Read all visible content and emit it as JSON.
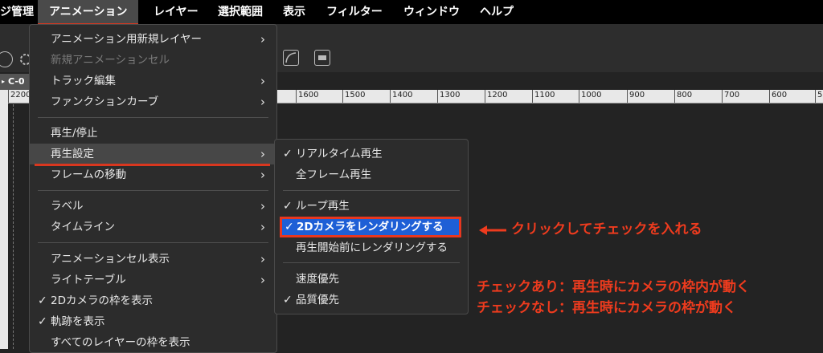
{
  "menubar": {
    "items": [
      "ジ管理",
      "アニメーション",
      "レイヤー",
      "選択範囲",
      "表示",
      "フィルター",
      "ウィンドウ",
      "ヘルプ"
    ]
  },
  "tab": {
    "label": "C-0"
  },
  "ruler": {
    "ticks": [
      "2200",
      "1600",
      "1500",
      "1400",
      "1300",
      "1200",
      "1100",
      "1000",
      "900",
      "800",
      "700",
      "600",
      "5"
    ]
  },
  "menu": {
    "items": [
      {
        "label": "アニメーション用新規レイヤー",
        "submenu": true
      },
      {
        "label": "新規アニメーションセル",
        "disabled": true
      },
      {
        "label": "トラック編集",
        "submenu": true
      },
      {
        "label": "ファンクションカーブ",
        "submenu": true
      },
      {
        "label": "再生/停止"
      },
      {
        "label": "再生設定",
        "submenu": true,
        "highlighted": true
      },
      {
        "label": "フレームの移動",
        "submenu": true
      },
      {
        "label": "ラベル",
        "submenu": true
      },
      {
        "label": "タイムライン",
        "submenu": true
      },
      {
        "label": "アニメーションセル表示",
        "submenu": true
      },
      {
        "label": "ライトテーブル",
        "submenu": true
      },
      {
        "label": "2Dカメラの枠を表示",
        "checked": true
      },
      {
        "label": "軌跡を表示",
        "checked": true
      },
      {
        "label": "すべてのレイヤーの枠を表示"
      }
    ]
  },
  "submenu": {
    "items": [
      {
        "label": "リアルタイム再生",
        "checked": true
      },
      {
        "label": "全フレーム再生"
      },
      {
        "label": "ループ再生",
        "checked": true
      },
      {
        "label": "2Dカメラをレンダリングする",
        "checked": true,
        "selected": true
      },
      {
        "label": "再生開始前にレンダリングする"
      },
      {
        "label": "速度優先"
      },
      {
        "label": "品質優先",
        "checked": true
      }
    ]
  },
  "annotations": {
    "arrow_text": "クリックしてチェックを入れる",
    "line1": "チェックあり：再生時にカメラの枠内が動く",
    "line2": "チェックなし：再生時にカメラの枠が動く"
  },
  "colors": {
    "accent_red": "#e8371f",
    "selection_blue": "#1e5fd6"
  }
}
